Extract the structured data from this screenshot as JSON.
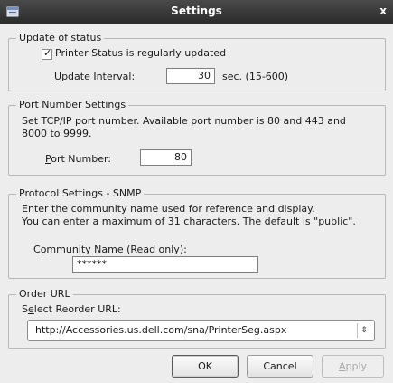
{
  "window": {
    "title": "Settings",
    "close_glyph": "x",
    "icon": "window-menu-icon"
  },
  "status": {
    "legend": "Update of status",
    "checkbox_label": "Printer Status is regularly updated",
    "checked": true,
    "interval_label_u": "U",
    "interval_label_rest": "pdate Interval:",
    "interval_value": "30",
    "interval_hint": "sec. (15-600)"
  },
  "port": {
    "legend": "Port Number Settings",
    "description": "Set TCP/IP port number. Available port number is 80 and 443 and 8000 to 9999.",
    "label_u": "P",
    "label_rest": "ort Number:",
    "value": "80"
  },
  "snmp": {
    "legend": "Protocol Settings - SNMP",
    "line1": "Enter the community name used for reference and display.",
    "line2": "You can enter a maximum of 31 characters. The default is \"public\".",
    "label_pre": "C",
    "label_u": "o",
    "label_rest": "mmunity Name (Read only):",
    "value": "******"
  },
  "order": {
    "legend": "Order URL",
    "label_pre": "S",
    "label_u": "e",
    "label_rest": "lect Reorder URL:",
    "selected": "http://Accessories.us.dell.com/sna/PrinterSeg.aspx"
  },
  "buttons": {
    "ok": "OK",
    "cancel": "Cancel",
    "apply_u": "A",
    "apply_rest": "pply"
  }
}
